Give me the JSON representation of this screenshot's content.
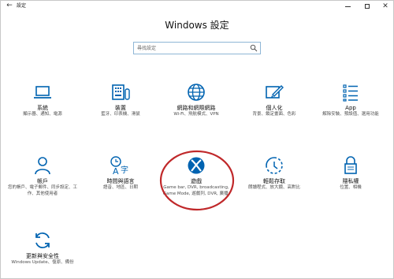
{
  "window": {
    "back_glyph": "←",
    "app_title": "設定",
    "controls": {
      "minimize_glyph": "",
      "maximize_glyph": "",
      "close_glyph": "✕"
    }
  },
  "page": {
    "title": "Windows 設定"
  },
  "search": {
    "placeholder": "尋找設定"
  },
  "tiles": [
    {
      "name": "系統",
      "desc": "顯示器、通知、電源",
      "icon": "laptop-icon"
    },
    {
      "name": "裝置",
      "desc": "藍牙、印表機、滑鼠",
      "icon": "keyboard-device-icon"
    },
    {
      "name": "網路和網際網路",
      "desc": "Wi-Fi、飛航模式、VPN",
      "icon": "globe-icon"
    },
    {
      "name": "個人化",
      "desc": "背景、鎖定畫面、色彩",
      "icon": "paint-pen-icon"
    },
    {
      "name": "App",
      "desc": "解除安裝、預設值、選用功能",
      "icon": "app-list-icon"
    },
    {
      "name": "帳戶",
      "desc": "您的帳戶、電子郵件、同步設定、工作、其他使用者",
      "icon": "person-icon"
    },
    {
      "name": "時間與語言",
      "desc": "語音、地區、日期",
      "icon": "time-language-icon"
    },
    {
      "name": "遊戲",
      "desc": "Game bar, DVR, broadcasting, Game Mode, 遊戲列, DVR, 廣播,",
      "icon": "xbox-icon"
    },
    {
      "name": "輕鬆存取",
      "desc": "朗讀程式、放大鏡、高對比",
      "icon": "ease-of-access-icon"
    },
    {
      "name": "隱私權",
      "desc": "位置、相機",
      "icon": "lock-icon"
    },
    {
      "name": "更新與安全性",
      "desc": "Windows Update、復原、備份",
      "icon": "update-sync-icon"
    }
  ],
  "colors": {
    "accent": "#0063b1",
    "annotation_circle": "#c0282a"
  }
}
